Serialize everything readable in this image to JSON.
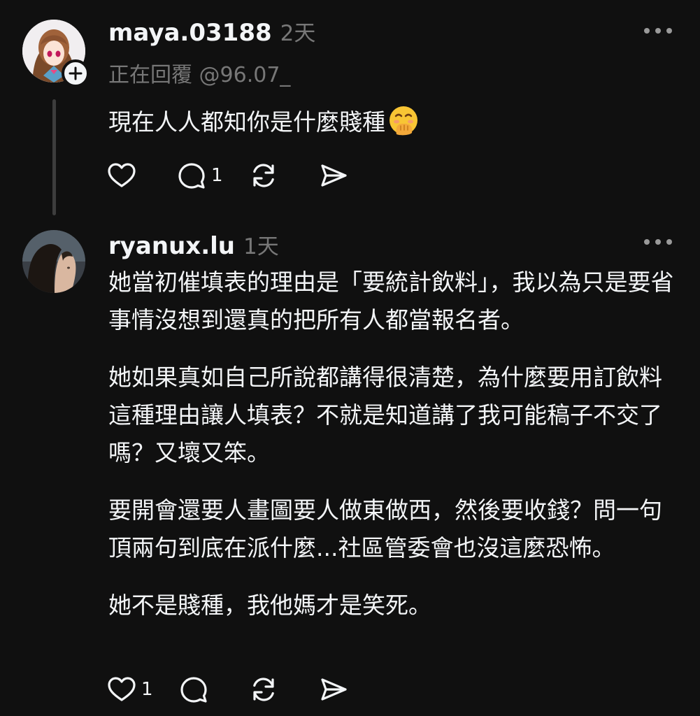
{
  "posts": [
    {
      "username": "maya.03188",
      "time": "2天",
      "reply_to": "正在回覆 @96.07_",
      "paragraphs": [
        "現在人人都知你是什麼賤種"
      ],
      "emoji": "hand-over-mouth-emoji",
      "actions": {
        "like_count": "",
        "comment_count": "1",
        "repost_count": "",
        "share_count": ""
      }
    },
    {
      "username": "ryanux.lu",
      "time": "1天",
      "paragraphs": [
        "她當初催填表的理由是「要統計飲料」，我以為只是要省事情沒想到還真的把所有人都當報名者。",
        "她如果真如自己所說都講得很清楚，為什麼要用訂飲料這種理由讓人填表？不就是知道講了我可能稿子不交了嗎？又壞又笨。",
        "要開會還要人畫圖要人做東做西，然後要收錢？問一句頂兩句到底在派什麼...社區管委會也沒這麼恐怖。",
        "她不是賤種，我他媽才是笑死。"
      ],
      "actions": {
        "like_count": "1",
        "comment_count": "",
        "repost_count": "",
        "share_count": ""
      }
    }
  ],
  "icons": {
    "more": "more-horizontal-icon",
    "like": "heart-icon",
    "comment": "comment-bubble-icon",
    "repost": "repost-icon",
    "share": "send-icon",
    "follow": "plus-icon"
  },
  "colors": {
    "background": "#101010",
    "text": "#f3f5f7",
    "secondary": "#777777",
    "thread_line": "#3d3d3d"
  }
}
